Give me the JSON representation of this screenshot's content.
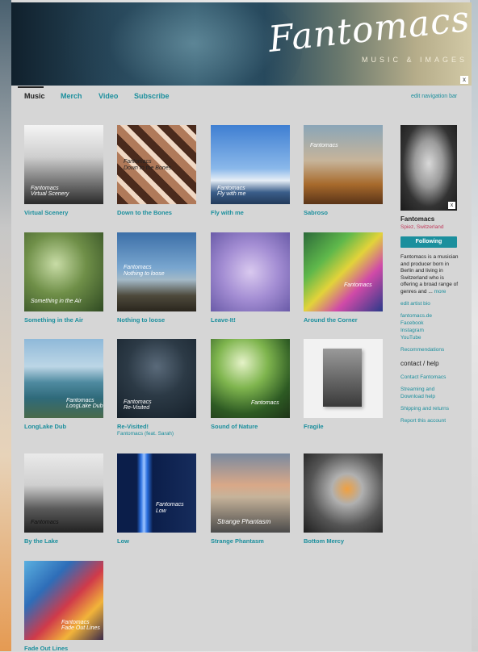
{
  "banner": {
    "logo": "Fantomacs",
    "tagline": "MUSIC & IMAGES",
    "close": "x"
  },
  "nav": {
    "tabs": [
      "Music",
      "Merch",
      "Video",
      "Subscribe"
    ],
    "edit": "edit navigation bar"
  },
  "albums": [
    {
      "title": "Virtual Scenery",
      "cover_text": "Fantomacs\nVirtual Scenery"
    },
    {
      "title": "Down to the Bones",
      "cover_text": "Fantomacs\nDown to the Bones"
    },
    {
      "title": "Fly with me",
      "cover_text": "Fantomacs\nFly with me"
    },
    {
      "title": "Sabroso",
      "cover_text": "Fantomacs"
    },
    {
      "title": "Something in the Air",
      "cover_text": "Something in the Air"
    },
    {
      "title": "Nothing to loose",
      "cover_text": "Fantomacs\nNothing to loose"
    },
    {
      "title": "Leave-It!",
      "cover_text": ""
    },
    {
      "title": "Around the Corner",
      "cover_text": "Fantomacs"
    },
    {
      "title": "LongLake Dub",
      "cover_text": "Fantomacs\nLongLake Dub"
    },
    {
      "title": "Re-Visited!",
      "subtitle": "Fantomacs (feat. Sarah)",
      "cover_text": "Fantomacs\nRe-Visited"
    },
    {
      "title": "Sound of Nature",
      "cover_text": "Fantomacs"
    },
    {
      "title": "Fragile",
      "cover_text": ""
    },
    {
      "title": "By the Lake",
      "cover_text": "Fantomacs"
    },
    {
      "title": "Low",
      "cover_text": "Fantomacs\nLow"
    },
    {
      "title": "Strange Phantasm",
      "cover_text": "Strange Phantasm"
    },
    {
      "title": "Bottom Mercy",
      "cover_text": ""
    },
    {
      "title": "Fade Out Lines",
      "cover_text": "Fantomacs\nFade Out Lines"
    }
  ],
  "artist": {
    "name": "Fantomacs",
    "location": "Spiez, Switzerland",
    "follow_label": "Following",
    "bio": "Fantomacs is a musician and producer born in Berlin and living in Switzerland who is offering a broad range of genres and ...",
    "bio_more": "more",
    "photo_close": "x",
    "links": [
      "edit artist bio",
      "fantomacs.de",
      "Facebook",
      "Instagram",
      "YouTube",
      "Recommendations"
    ],
    "contact_heading": "contact / help",
    "contact_links": [
      "Contact Fantomacs",
      "Streaming and Download help",
      "Shipping and returns",
      "Report this account"
    ]
  },
  "colors": {
    "link": "#1b8f9d",
    "location": "#c0395a",
    "follow": "#1b8f9d"
  }
}
